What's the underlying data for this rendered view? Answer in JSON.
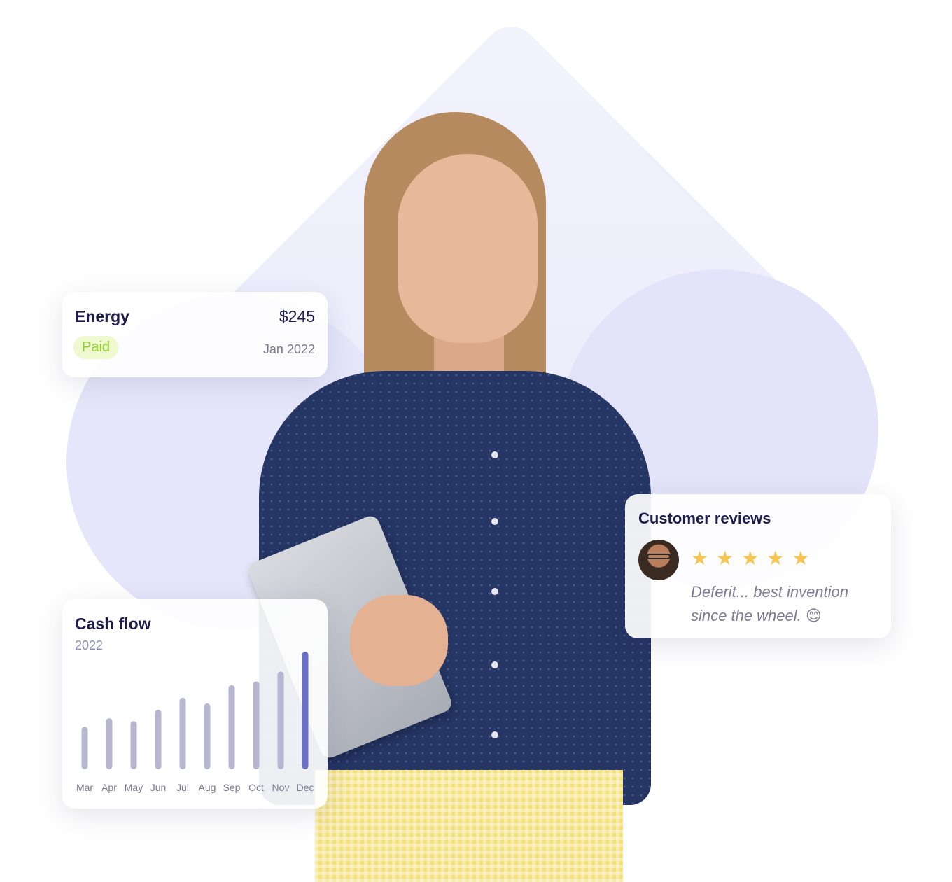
{
  "energy_card": {
    "title": "Energy",
    "amount": "$245",
    "status": "Paid",
    "date": "Jan 2022"
  },
  "reviews_card": {
    "title": "Customer reviews",
    "stars": "★★★★★",
    "rating": 5,
    "quote": "Deferit... best invention since the wheel. 😊"
  },
  "cash_card": {
    "title": "Cash flow",
    "year": "2022"
  },
  "colors": {
    "accent": "#6b6fc8",
    "bar": "#b7b5cf",
    "title_text": "#1f1d4d",
    "paid_bg": "#eef9cf",
    "paid_text": "#8fcf2a",
    "star": "#f5c452"
  },
  "chart_data": {
    "type": "bar",
    "categories": [
      "Mar",
      "Apr",
      "May",
      "Jun",
      "Jul",
      "Aug",
      "Sep",
      "Oct",
      "Nov",
      "Dec"
    ],
    "values": [
      60,
      72,
      68,
      84,
      101,
      93,
      119,
      124,
      138,
      166
    ],
    "highlight": "Dec",
    "title": "Cash flow",
    "subtitle": "2022",
    "ylim": [
      0,
      170
    ]
  }
}
